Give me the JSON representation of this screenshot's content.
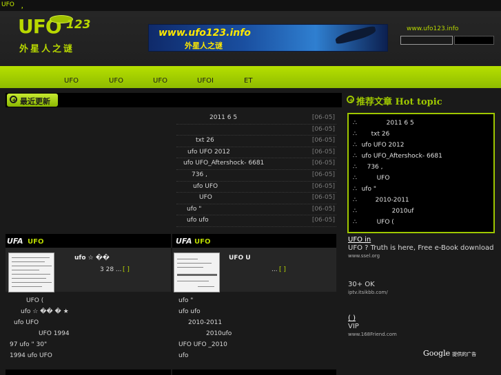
{
  "topbar": {
    "title": "UFO",
    "sep": "，"
  },
  "header": {
    "logo_text": "UFO",
    "logo_num": "123",
    "logo_cn": "外星人之谜",
    "banner_url": "www.ufo123.info",
    "banner_cn": "外星人之谜",
    "site_url": "www.ufo123.info"
  },
  "nav": [
    "UFO",
    "UFO",
    "UFO",
    "UFOI",
    "ET"
  ],
  "latest": {
    "label": "最近更新",
    "items": [
      {
        "title": "2011  6  5",
        "date": "[06-05]"
      },
      {
        "title": "",
        "date": "[06-05]"
      },
      {
        "title": "txt          26",
        "date": "[06-05]"
      },
      {
        "title": "ufo    UFO   2012",
        "date": "[06-05]"
      },
      {
        "title": "ufo    UFO_Aftershock-    6681",
        "date": "[06-05]"
      },
      {
        "title": "736 ,",
        "date": "[06-05]"
      },
      {
        "title": "ufo            UFO",
        "date": "[06-05]"
      },
      {
        "title": "UFO",
        "date": "[06-05]"
      },
      {
        "title": "ufo                \"",
        "date": "[06-05]"
      },
      {
        "title": "ufo    ufo",
        "date": "[06-05]"
      }
    ]
  },
  "section1": {
    "icon": "UFA",
    "name": "UFO",
    "summary_title": "ufo    ☆  ��",
    "summary_text": "3 28 ...",
    "more": "[  ]",
    "list": [
      "UFO         (",
      "ufo  ☆ ��    � ★",
      "ufo  UFO",
      "UFO    1994",
      "97   ufo      \"    30\"",
      "1994   ufo     UFO"
    ]
  },
  "section2": {
    "icon": "UFA",
    "name": "UFO",
    "summary_title": "UFO                    U",
    "summary_text": "...",
    "more": "[  ]",
    "list": [
      "ufo               \"",
      "ufo   ufo",
      "2010-2011",
      "2010ufo",
      "UFO          UFO     _2010",
      "ufo"
    ]
  },
  "hot": {
    "label": "推荐文章 Hot topic",
    "items": [
      "2011  6  5",
      "txt          26",
      "ufo    UFO   2012",
      "ufo    UFO_Aftershock-    6681",
      "736 ,",
      "UFO",
      "ufo                \"",
      "2010-2011",
      "2010uf",
      "UFO          ("
    ]
  },
  "ads": [
    {
      "title": "UFO in      ",
      "desc": "UFO              ? Truth is here, Free e-Book download",
      "url": "www.ssel.org"
    },
    {
      "title": "       ",
      "desc": "30+                        OK",
      "url": "iptv.itsikbb.com/"
    },
    {
      "title": "      (   )",
      "desc": "                            VIP",
      "url": "www.168Friend.com"
    }
  ],
  "google": {
    "brand": "Google",
    "text": "提供的广告"
  }
}
